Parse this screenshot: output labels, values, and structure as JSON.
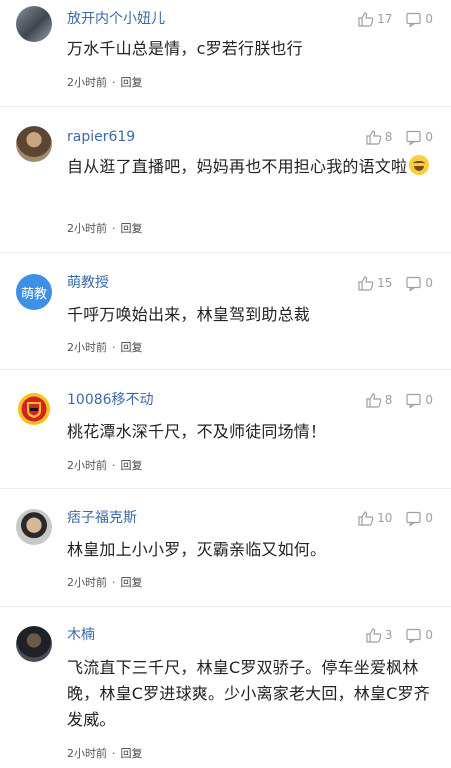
{
  "comments": [
    {
      "username": "放开内个小妞儿",
      "likes": "17",
      "dislikes": "0",
      "text": "万水千山总是情，c罗若行朕也行",
      "time": "2小时前",
      "reply": "回复"
    },
    {
      "username": "rapier619",
      "likes": "8",
      "dislikes": "0",
      "text": "自从逛了直播吧，妈妈再也不用担心我的语文啦",
      "time": "2小时前",
      "reply": "回复"
    },
    {
      "username": "萌教授",
      "avatar_text": "萌教",
      "likes": "15",
      "dislikes": "0",
      "text": "千呼万唤始出来，林皇驾到助总裁",
      "time": "2小时前",
      "reply": "回复"
    },
    {
      "username": "10086移不动",
      "likes": "8",
      "dislikes": "0",
      "text": "桃花潭水深千尺，不及师徒同场情！",
      "time": "2小时前",
      "reply": "回复"
    },
    {
      "username": "痞子福克斯",
      "likes": "10",
      "dislikes": "0",
      "text": "林皇加上小小罗，灭霸亲临又如何。",
      "time": "2小时前",
      "reply": "回复"
    },
    {
      "username": "木楠",
      "likes": "3",
      "dislikes": "0",
      "text": "飞流直下三千尺，林皇C罗双骄子。停车坐爱枫林晚，林皇C罗进球爽。少小离家老大回，林皇C罗齐发威。",
      "time": "2小时前",
      "reply": "回复"
    }
  ],
  "colors": {
    "username": "#3c6aa8",
    "icon": "#9aa0a6",
    "avatar_bg": "#3e8fe6"
  },
  "icons": {
    "like": "thumbs-up-icon",
    "dislike": "thumbs-down-icon",
    "emoji": "laughing-emoji-icon",
    "club_crest": "manchester-united-crest-icon"
  }
}
